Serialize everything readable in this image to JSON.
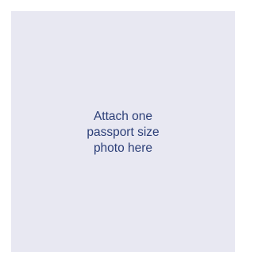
{
  "photo_upload": {
    "lines": [
      "Attach one",
      "passport size",
      "photo here"
    ],
    "colors": {
      "background": "#e8e8f2",
      "text": "#2c3f78"
    }
  }
}
